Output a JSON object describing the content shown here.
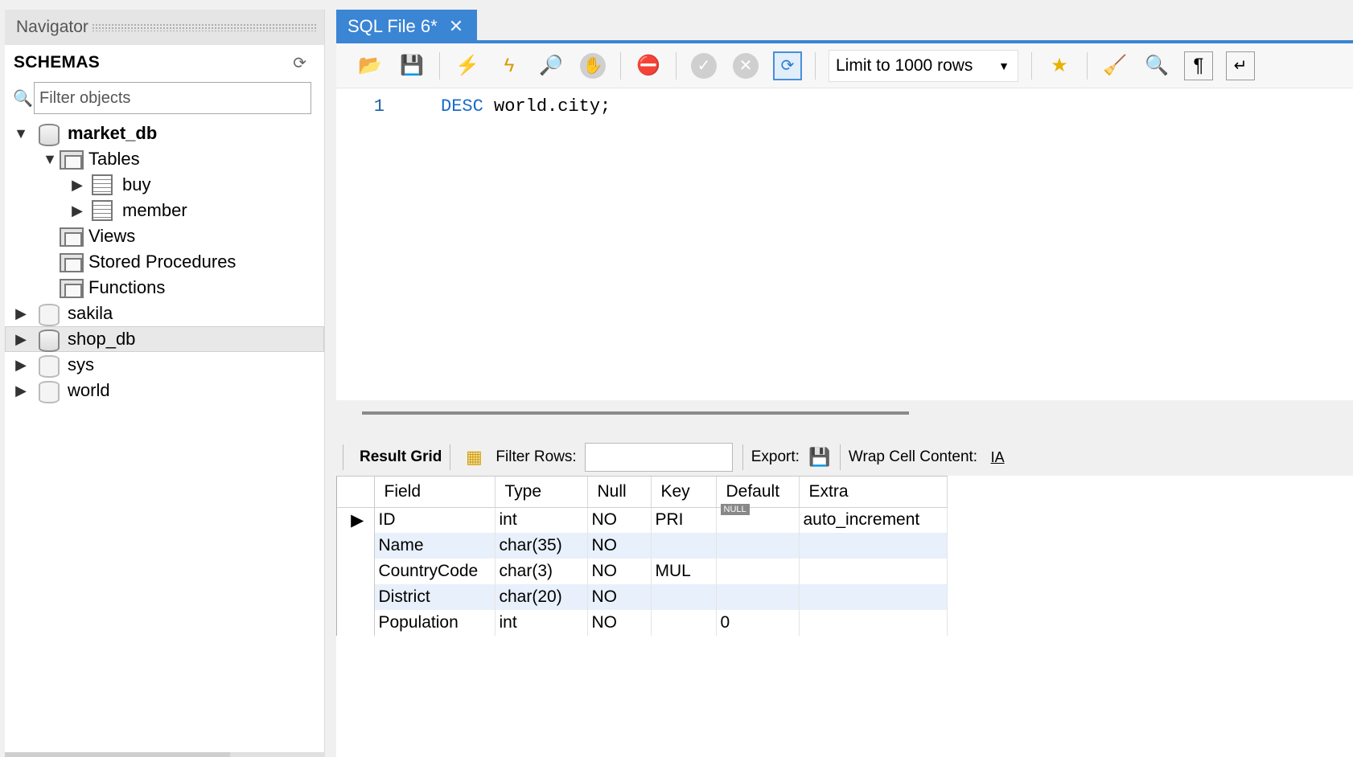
{
  "navigator": {
    "title": "Navigator",
    "schemas_label": "SCHEMAS",
    "filter_placeholder": "Filter objects",
    "tree": [
      {
        "label": "market_db",
        "expanded": true
      },
      {
        "label": "Tables"
      },
      {
        "label": "buy"
      },
      {
        "label": "member"
      },
      {
        "label": "Views"
      },
      {
        "label": "Stored Procedures"
      },
      {
        "label": "Functions"
      },
      {
        "label": "sakila"
      },
      {
        "label": "shop_db",
        "selected": true
      },
      {
        "label": "sys"
      },
      {
        "label": "world"
      }
    ]
  },
  "editor": {
    "tab_label": "SQL File 6*",
    "limit_label": "Limit to 1000 rows",
    "line_number": "1",
    "code_keyword": "DESC",
    "code_rest": " world.city;"
  },
  "result_toolbar": {
    "grid_label": "Result Grid",
    "filter_rows_label": "Filter Rows:",
    "export_label": "Export:",
    "wrap_label": "Wrap Cell Content:"
  },
  "result_grid": {
    "columns": [
      "Field",
      "Type",
      "Null",
      "Key",
      "Default",
      "Extra"
    ],
    "null_badge": "NULL",
    "rows": [
      [
        "ID",
        "int",
        "NO",
        "PRI",
        "",
        "auto_increment"
      ],
      [
        "Name",
        "char(35)",
        "NO",
        "",
        "",
        ""
      ],
      [
        "CountryCode",
        "char(3)",
        "NO",
        "MUL",
        "",
        ""
      ],
      [
        "District",
        "char(20)",
        "NO",
        "",
        "",
        ""
      ],
      [
        "Population",
        "int",
        "NO",
        "",
        "0",
        ""
      ]
    ]
  },
  "colors": {
    "accent": "#3a85d4",
    "keyword": "#1a6bc9",
    "row_alt": "#e8f0fb"
  }
}
